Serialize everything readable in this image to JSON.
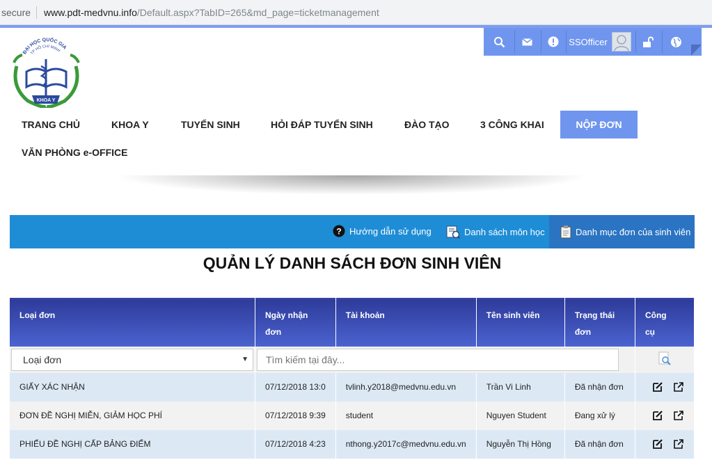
{
  "browser": {
    "secure_label": "secure",
    "url_host": "www.pdt-medvnu.info",
    "url_path": "/Default.aspx?TabID=265&md_page=ticketmanagement"
  },
  "toolbar": {
    "username": "SSOfficer",
    "icons": [
      "search-icon",
      "mail-icon",
      "alert-icon",
      "avatar",
      "unlock-icon",
      "globe-icon"
    ]
  },
  "logo": {
    "arc_text": "ĐẠI HỌC QUỐC GIA",
    "arc_subtext": "TP HỒ CHÍ MINH",
    "ribbon_text": "KHOA Y"
  },
  "nav": {
    "items": [
      "TRANG CHỦ",
      "KHOA Y",
      "TUYỂN SINH",
      "HỎI ĐÁP TUYỂN SINH",
      "ĐÀO TẠO",
      "3 CÔNG KHAI",
      "NỘP ĐƠN",
      "VĂN PHÒNG e-OFFICE"
    ],
    "active": "NỘP ĐƠN"
  },
  "bluebar": {
    "help": "Hướng dẫn sử dụng",
    "subjects": "Danh sách môn học",
    "student_forms": "Danh mục đơn của sinh viên"
  },
  "page_title": "QUẢN LÝ DANH SÁCH ĐƠN SINH VIÊN",
  "table": {
    "headers": {
      "type": "Loại đơn",
      "date_l1": "Ngày nhận",
      "date_l2": "đơn",
      "account": "Tài khoản",
      "name": "Tên sinh viên",
      "status_l1": "Trạng thái",
      "status_l2": "đơn",
      "tools_l1": "Công",
      "tools_l2": "cụ"
    },
    "filter": {
      "type_selected": "Loại đơn",
      "search_placeholder": "Tìm kiếm tại đây..."
    },
    "rows": [
      {
        "type": "GIẤY XÁC NHẬN",
        "date": "07/12/2018 13:0",
        "account": "tvlinh.y2018@medvnu.edu.vn",
        "name": "Trần Vi Linh",
        "status": "Đã nhận đơn"
      },
      {
        "type": "ĐƠN ĐỀ NGHỊ MIỄN, GIẢM HỌC PHÍ",
        "date": "07/12/2018 9:39",
        "account": "student",
        "name": "Nguyen Student",
        "status": "Đang xử lý"
      },
      {
        "type": "PHIẾU ĐỀ NGHỊ CẤP BẢNG ĐIỂM",
        "date": "07/12/2018 4:23",
        "account": "nthong.y2017c@medvnu.edu.vn",
        "name": "Nguyễn Thị Hồng",
        "status": "Đã nhận đơn"
      }
    ]
  },
  "colors": {
    "accent": "#6f95ee",
    "bluebar": "#1f8dd6",
    "header_dark": "#2e3b9a",
    "row_odd": "#dce9f5",
    "row_even": "#f2f2f2"
  }
}
